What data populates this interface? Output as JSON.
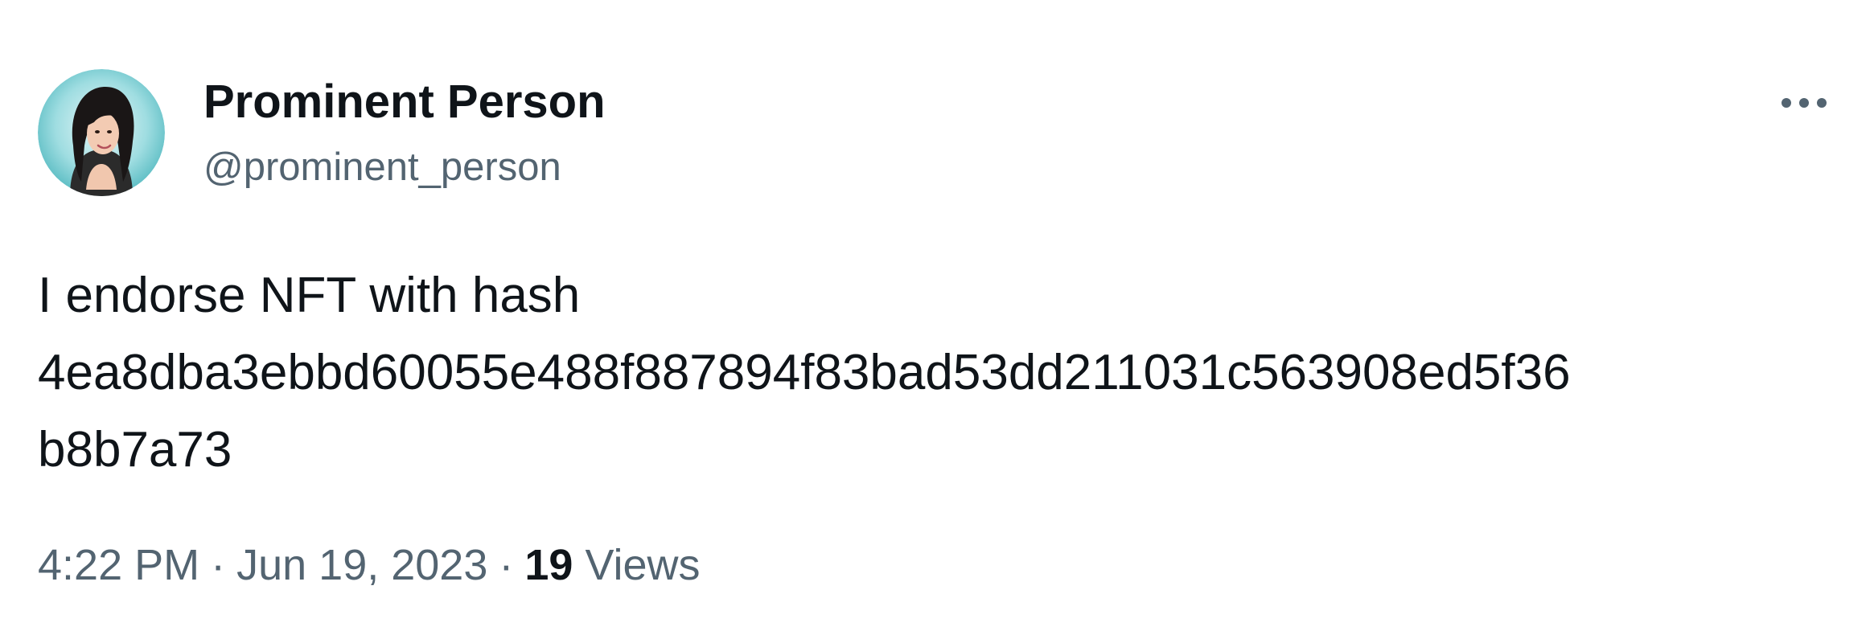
{
  "user": {
    "display_name": "Prominent Person",
    "handle": "@prominent_person",
    "avatar_icon": "avatar-portrait"
  },
  "more_icon": "more-horizontal-icon",
  "tweet": {
    "text_lines": [
      "I endorse NFT with hash",
      "4ea8dba3ebbd60055e488f887894f83bad53dd211031c563908ed5f36",
      "b8b7a73"
    ]
  },
  "meta": {
    "time": "4:22 PM",
    "separator": "·",
    "date": "Jun 19, 2023",
    "views_count": "19",
    "views_label": "Views"
  },
  "colors": {
    "text_primary": "#0f1419",
    "text_secondary": "#536471",
    "background": "#ffffff",
    "avatar_ring": "#7fd1d6"
  }
}
